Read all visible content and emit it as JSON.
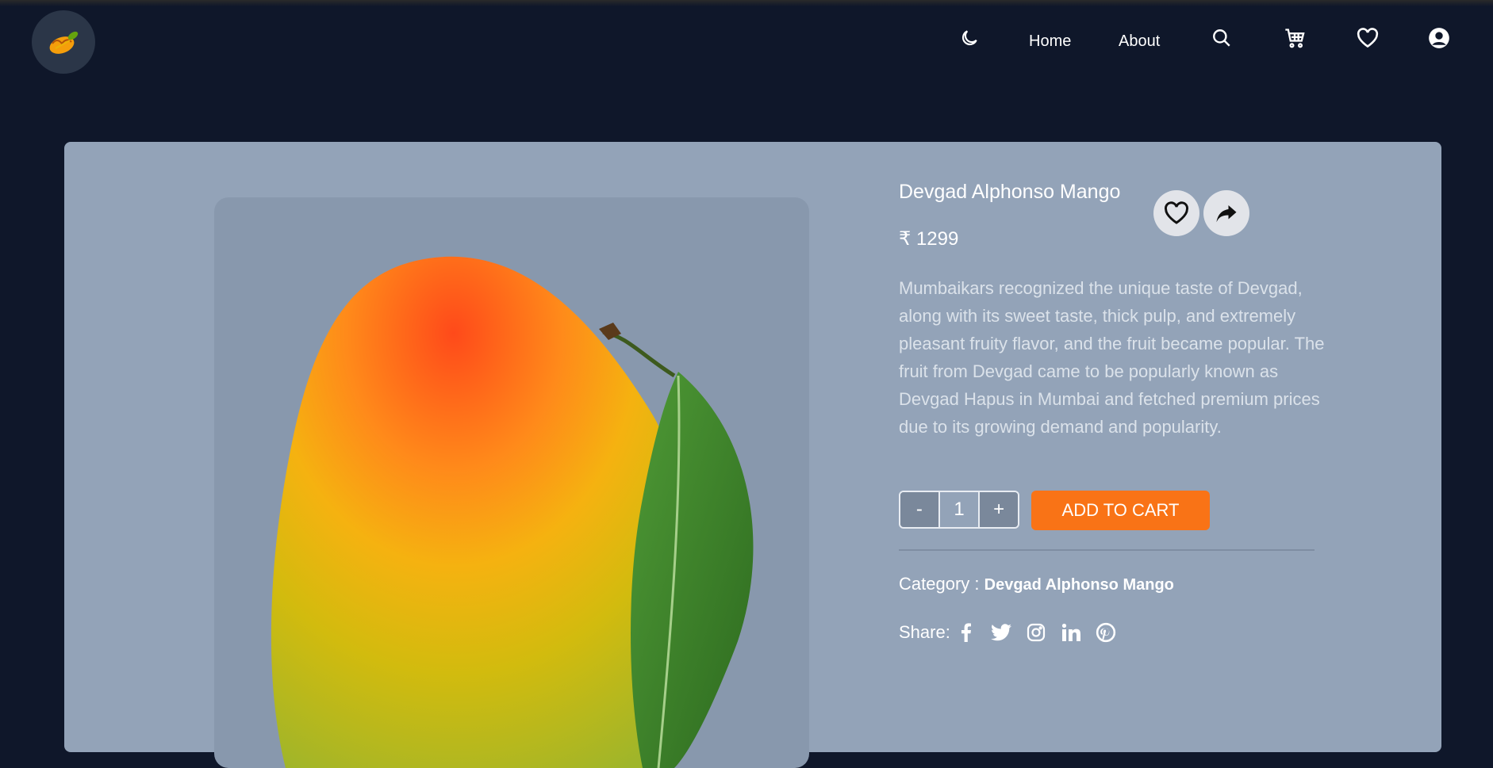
{
  "nav": {
    "links": [
      "Home",
      "About"
    ],
    "icons": {
      "theme": "moon-icon",
      "search": "search-icon",
      "cart": "cart-icon",
      "wishlist": "heart-icon",
      "account": "user-circle-icon"
    }
  },
  "product": {
    "title": "Devgad Alphonso Mango",
    "price": "₹ 1299",
    "description": "Mumbaikars recognized the unique taste of Devgad, along with its sweet taste, thick pulp, and extremely pleasant fruity flavor, and the fruit became popular. The fruit from Devgad came to be popularly known as Devgad Hapus in Mumbai and fetched premium prices due to its growing demand and popularity.",
    "quantity": "1",
    "decrement_label": "-",
    "increment_label": "+",
    "add_to_cart_label": "ADD TO CART",
    "category_label": "Category :",
    "category_value": "Devgad Alphonso Mango",
    "share_label": "Share:",
    "share_icons": [
      "facebook-icon",
      "twitter-icon",
      "instagram-icon",
      "linkedin-icon",
      "pinterest-icon"
    ]
  },
  "colors": {
    "background": "#0f172a",
    "card": "#93a3b8",
    "accent": "#f97316"
  }
}
